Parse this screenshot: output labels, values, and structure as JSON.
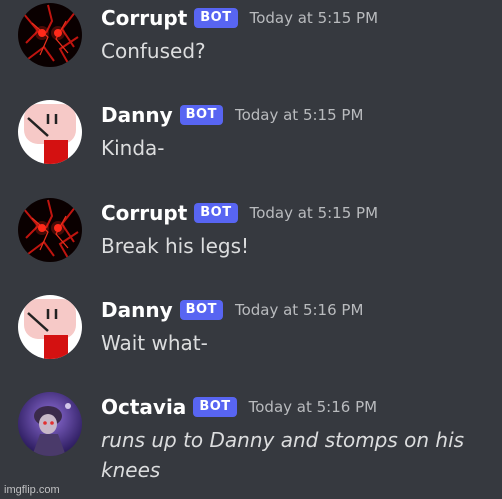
{
  "messages": [
    {
      "username": "Corrupt",
      "tag": "BOT",
      "timestamp": "Today at 5:15 PM",
      "text": "Confused?",
      "avatar": "corrupt-avatar",
      "italic": false
    },
    {
      "username": "Danny",
      "tag": "BOT",
      "timestamp": "Today at 5:15 PM",
      "text": "Kinda-",
      "avatar": "danny-avatar",
      "italic": false
    },
    {
      "username": "Corrupt",
      "tag": "BOT",
      "timestamp": "Today at 5:15 PM",
      "text": "Break his legs!",
      "avatar": "corrupt-avatar",
      "italic": false
    },
    {
      "username": "Danny",
      "tag": "BOT",
      "timestamp": "Today at 5:16 PM",
      "text": "Wait what-",
      "avatar": "danny-avatar",
      "italic": false
    },
    {
      "username": "Octavia",
      "tag": "BOT",
      "timestamp": "Today at 5:16 PM",
      "text": "runs up to Danny and stomps on his knees",
      "avatar": "octavia-avatar",
      "italic": true
    }
  ],
  "watermark": "imgflip.com",
  "colors": {
    "background": "#36393f",
    "bot_tag": "#5865f2",
    "username": "#ffffff",
    "timestamp": "#b9bbbe",
    "message_text": "#dcddde"
  }
}
